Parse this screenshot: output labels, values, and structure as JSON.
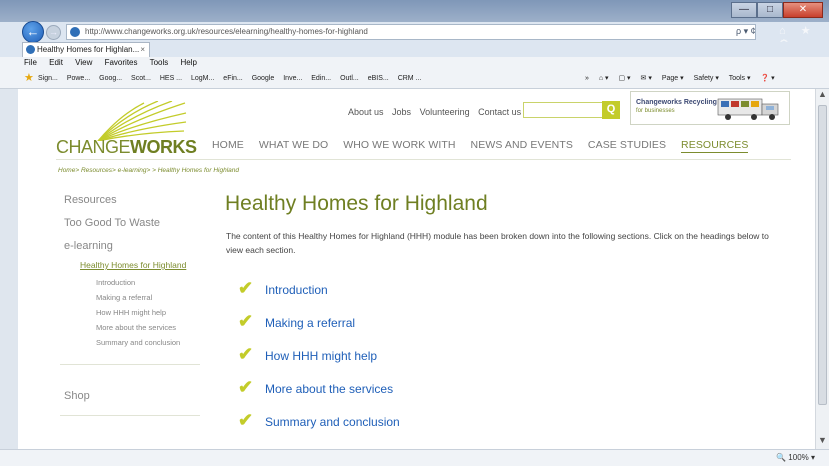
{
  "browser": {
    "url": "http://www.changeworks.org.uk/resources/elearning/healthy-homes-for-highland",
    "tab_title": "Healthy Homes for Highlan...",
    "tab_close": "×",
    "back_glyph": "←",
    "forward_glyph": "→",
    "addr_tools": "ρ ▾ ¢",
    "home_icons": "⌂ ★ ⚙",
    "win_min": "—",
    "win_max": "□",
    "win_close": "✕",
    "menu": [
      "File",
      "Edit",
      "View",
      "Favorites",
      "Tools",
      "Help"
    ],
    "favorites": [
      "Sign...",
      "Powe...",
      "Goog...",
      "Scot...",
      "HES ...",
      "LogM...",
      "eFin...",
      "Google",
      "Inve...",
      "Edin...",
      "Outl...",
      "eBIS...",
      "CRM ..."
    ],
    "fav_tools": [
      "»",
      "⌂ ▾",
      "▢ ▾",
      "✉ ▾",
      "Page ▾",
      "Safety ▾",
      "Tools ▾",
      "❓ ▾"
    ],
    "zoom": "🔍 100%  ▾",
    "scroll_up": "▲",
    "scroll_down": "▼"
  },
  "site": {
    "logo_part1": "CHANGE",
    "logo_part2": "WORKS",
    "top_links": [
      "About us",
      "Jobs",
      "Volunteering",
      "Contact us"
    ],
    "search_placeholder": "",
    "search_glyph": "Q",
    "promo_title": "Changeworks Recycling",
    "promo_sub": "for businesses",
    "nav": [
      "HOME",
      "WHAT WE DO",
      "WHO WE WORK WITH",
      "NEWS AND EVENTS",
      "CASE STUDIES",
      "RESOURCES"
    ],
    "breadcrumb": "Home> Resources> e-learning> > Healthy Homes for Highland"
  },
  "sidebar": {
    "items": [
      "Resources",
      "Too Good To Waste",
      "e-learning"
    ],
    "current": "Healthy Homes for Highland",
    "subitems": [
      "Introduction",
      "Making a referral",
      "How HHH might help",
      "More about the services",
      "Summary and conclusion"
    ],
    "shop": "Shop"
  },
  "main": {
    "title": "Healthy Homes for Highland",
    "intro": "The content of this Healthy Homes for Highland (HHH) module has been broken down into the following sections. Click on the headings below to view each section.",
    "check_glyph": "✔",
    "sections": [
      "Introduction",
      "Making a referral",
      "How HHH might help",
      "More about the services",
      "Summary and conclusion"
    ]
  },
  "colors": {
    "brand_green": "#7c8c2e",
    "accent_lime": "#c3cc2a",
    "link_blue": "#1f5fb8"
  }
}
